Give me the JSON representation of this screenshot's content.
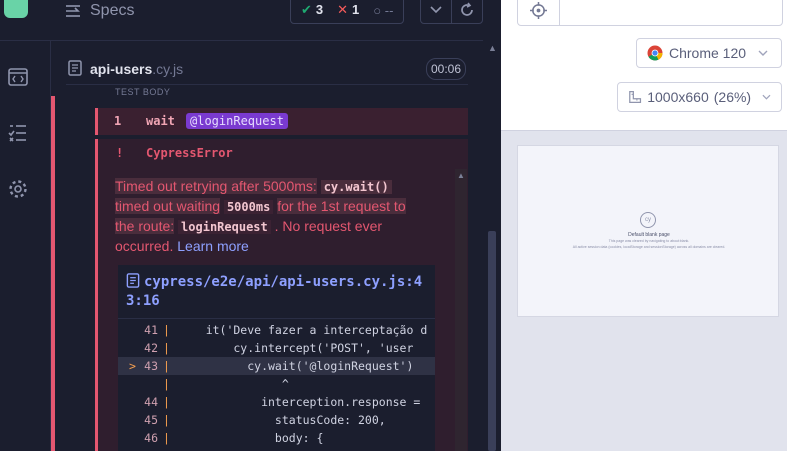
{
  "nav": {
    "logo_icon": "cypress-logo-icon",
    "items": [
      {
        "icon": "code-window-icon"
      },
      {
        "icon": "list-checks-icon"
      },
      {
        "icon": "gear-icon"
      }
    ]
  },
  "specs_bar": {
    "title": "Specs",
    "stats": {
      "passed": "3",
      "failed": "1",
      "pending": "--"
    },
    "buttons": [
      "chevron-down-icon",
      "refresh-icon"
    ]
  },
  "spec_file": {
    "name": "api-users",
    "ext": ".cy.js",
    "duration": "00:06"
  },
  "test_body_label": "TEST BODY",
  "command": {
    "number": "1",
    "name": "wait",
    "alias": "@loginRequest"
  },
  "error": {
    "bang": "!",
    "title": "CypressError",
    "msg_1": "Timed out retrying after 5000ms:",
    "code_1": "cy.wait()",
    "msg_2": "timed out waiting",
    "code_2": "5000ms",
    "msg_3": "for the 1st request to the route:",
    "code_3": "loginRequest",
    "msg_4": ". No request ever occurred.",
    "learn_more": "Learn more"
  },
  "code_frame": {
    "file": "cypress/e2e/api/api-users.cy.js:43:16",
    "lines": [
      {
        "n": "41",
        "arrow": "",
        "text": "    it('Deve fazer a interceptação d"
      },
      {
        "n": "42",
        "arrow": "",
        "text": "        cy.intercept('POST', 'user"
      },
      {
        "n": "43",
        "arrow": ">",
        "text": "          cy.wait('@loginRequest')"
      },
      {
        "n": "",
        "arrow": "",
        "text": "               ^"
      },
      {
        "n": "44",
        "arrow": "",
        "text": "            interception.response ="
      },
      {
        "n": "45",
        "arrow": "",
        "text": "              statusCode: 200,"
      },
      {
        "n": "46",
        "arrow": "",
        "text": "              body: {"
      }
    ]
  },
  "browser": {
    "name": "Chrome 120",
    "viewport": "1000x660",
    "zoom": "(26%)"
  },
  "preview": {
    "title": "Default blank page",
    "line1": "This page was cleared by navigating to about:blank.",
    "line2": "All active session data (cookies, localStorage and sessionStorage) across all domains are cleared."
  }
}
